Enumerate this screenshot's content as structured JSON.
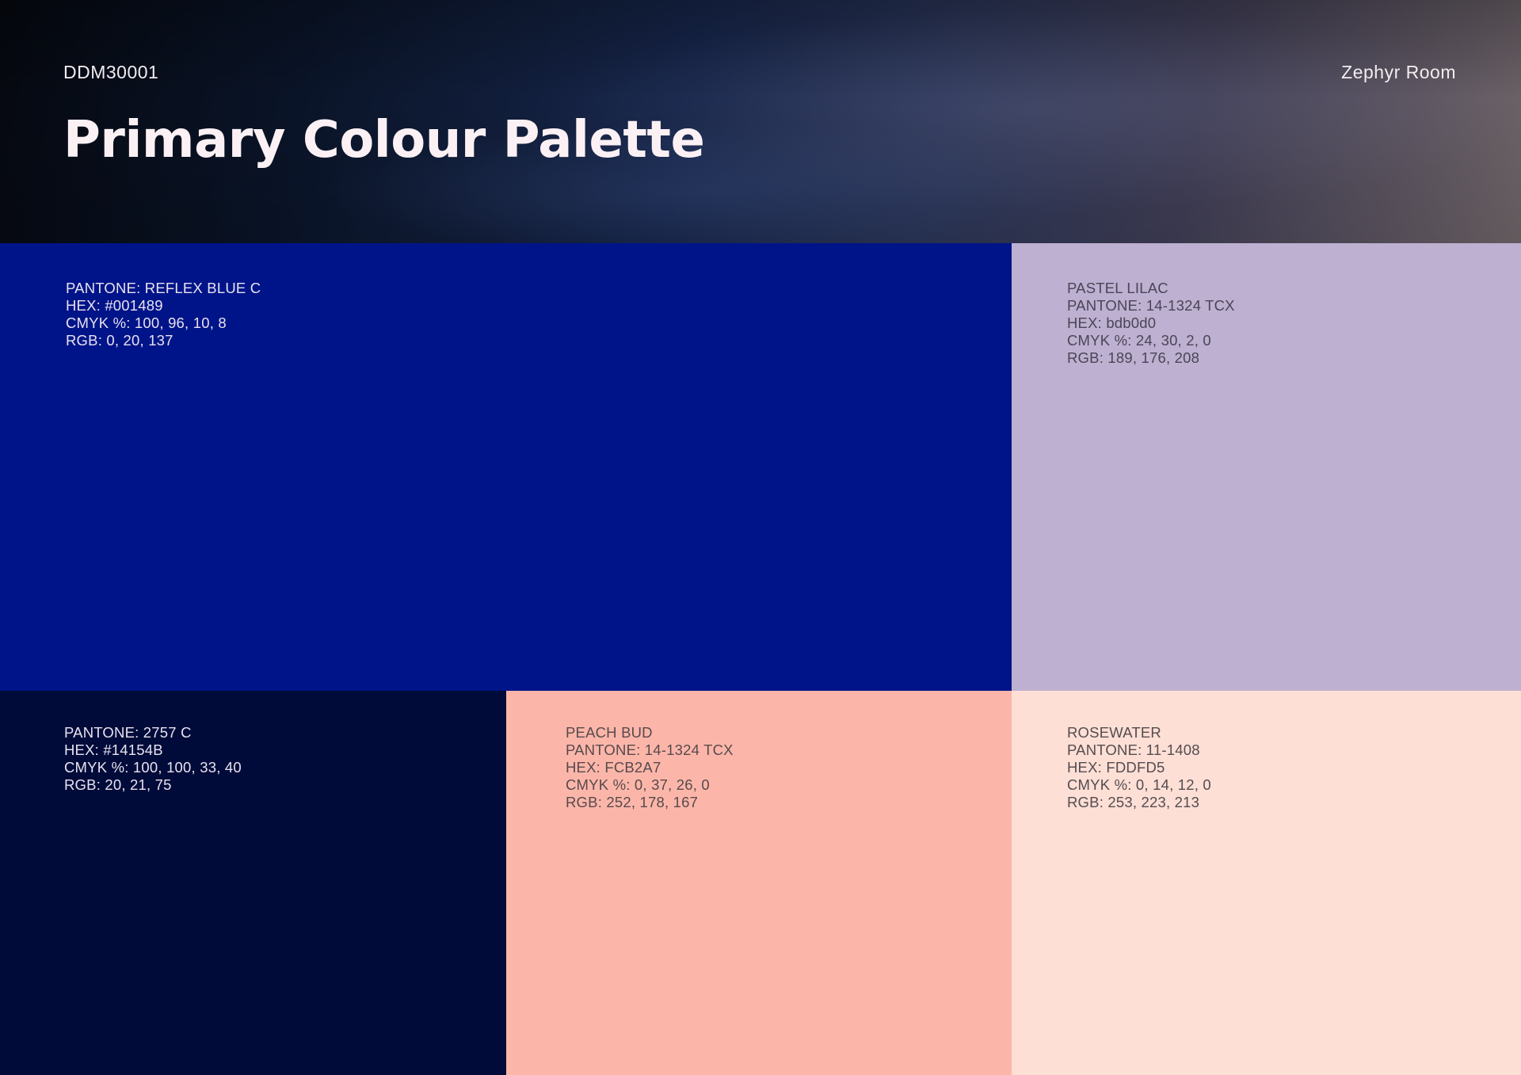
{
  "header": {
    "doc_code": "DDM30001",
    "project_name": "Zephyr Room",
    "title": "Primary Colour Palette"
  },
  "colors": {
    "header_gradient_start": "#05080f",
    "header_gradient_end": "#6e6468",
    "title_text": "#fbf1f4"
  },
  "swatches": {
    "reflex_blue": {
      "color": "#001489",
      "lines": [
        "PANTONE: REFLEX BLUE C",
        "HEX: #001489",
        "CMYK %: 100, 96, 10, 8",
        "RGB: 0, 20, 137"
      ]
    },
    "pastel_lilac": {
      "color": "#bdb0d0",
      "lines": [
        "PASTEL LILAC",
        "PANTONE: 14-1324 TCX",
        "HEX: bdb0d0",
        "CMYK %: 24, 30, 2, 0",
        "RGB: 189, 176, 208"
      ]
    },
    "pantone_2757": {
      "color": "#000b3a",
      "lines": [
        "PANTONE: 2757 C",
        "HEX:  #14154B",
        "CMYK %: 100, 100, 33, 40",
        "RGB: 20, 21, 75"
      ]
    },
    "peach_bud": {
      "color": "#fcb6a9",
      "lines": [
        "PEACH BUD",
        "PANTONE: 14-1324 TCX",
        "HEX: FCB2A7",
        "CMYK %: 0, 37, 26, 0",
        "RGB: 252, 178, 167"
      ]
    },
    "rosewater": {
      "color": "#fddfd5",
      "lines": [
        "ROSEWATER",
        "PANTONE: 11-1408",
        "HEX: FDDFD5",
        "CMYK %: 0, 14, 12, 0",
        "RGB: 253, 223, 213"
      ]
    }
  }
}
